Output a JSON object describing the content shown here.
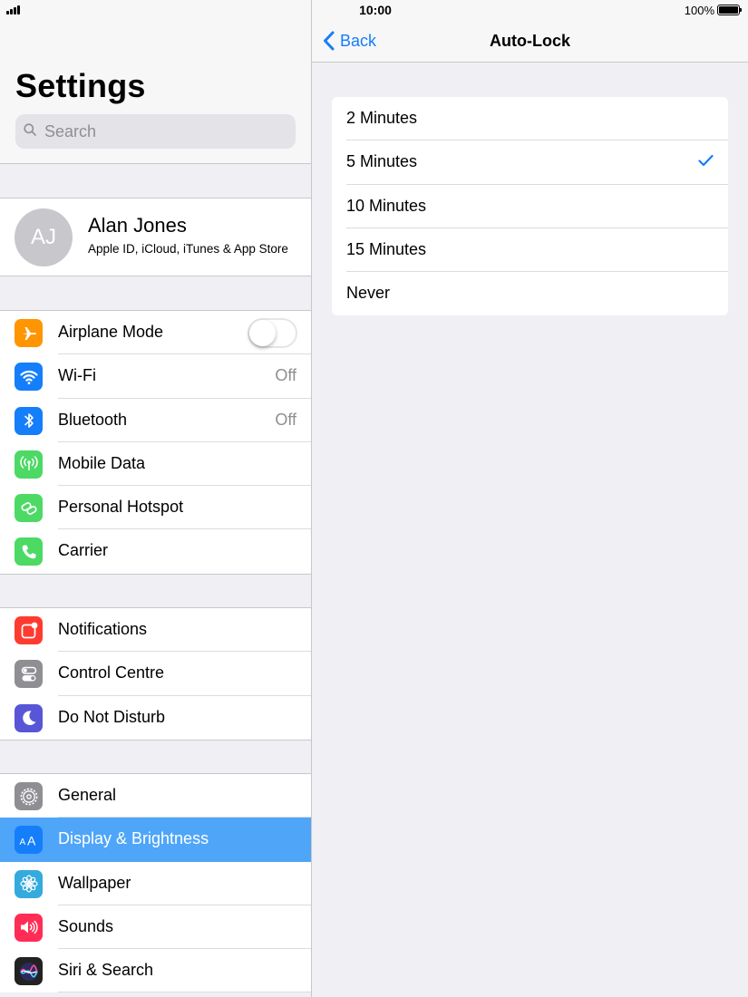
{
  "status_bar": {
    "time": "10:00",
    "battery": "100%"
  },
  "sidebar": {
    "title": "Settings",
    "search": {
      "placeholder": "Search"
    },
    "profile": {
      "initials": "AJ",
      "name": "Alan Jones",
      "subtitle": "Apple ID, iCloud, iTunes & App Store"
    },
    "groups": [
      [
        {
          "label": "Airplane Mode",
          "icon": "airplane-icon",
          "color": "#ff9500",
          "toggle": false
        },
        {
          "label": "Wi-Fi",
          "icon": "wifi-icon",
          "color": "#147efb",
          "value": "Off"
        },
        {
          "label": "Bluetooth",
          "icon": "bluetooth-icon",
          "color": "#147efb",
          "value": "Off"
        },
        {
          "label": "Mobile Data",
          "icon": "antenna-icon",
          "color": "#4cd964"
        },
        {
          "label": "Personal Hotspot",
          "icon": "hotspot-icon",
          "color": "#4cd964"
        },
        {
          "label": "Carrier",
          "icon": "phone-icon",
          "color": "#4cd964"
        }
      ],
      [
        {
          "label": "Notifications",
          "icon": "notifications-icon",
          "color": "#ff3b30"
        },
        {
          "label": "Control Centre",
          "icon": "control-centre-icon",
          "color": "#8e8e93"
        },
        {
          "label": "Do Not Disturb",
          "icon": "moon-icon",
          "color": "#5856d6"
        }
      ],
      [
        {
          "label": "General",
          "icon": "gear-icon",
          "color": "#8e8e93"
        },
        {
          "label": "Display & Brightness",
          "icon": "display-icon",
          "color": "#147efb",
          "selected": true
        },
        {
          "label": "Wallpaper",
          "icon": "wallpaper-icon",
          "color": "#35aadc"
        },
        {
          "label": "Sounds",
          "icon": "speaker-icon",
          "color": "#ff2d55"
        },
        {
          "label": "Siri & Search",
          "icon": "siri-icon",
          "color": "#222222"
        }
      ]
    ]
  },
  "detail": {
    "back_label": "Back",
    "title": "Auto-Lock",
    "options": [
      {
        "label": "2 Minutes",
        "checked": false
      },
      {
        "label": "5 Minutes",
        "checked": true
      },
      {
        "label": "10 Minutes",
        "checked": false
      },
      {
        "label": "15 Minutes",
        "checked": false
      },
      {
        "label": "Never",
        "checked": false
      }
    ]
  },
  "colors": {
    "accent": "#147efb",
    "selection": "#4fa5f8",
    "background": "#efeff4"
  }
}
